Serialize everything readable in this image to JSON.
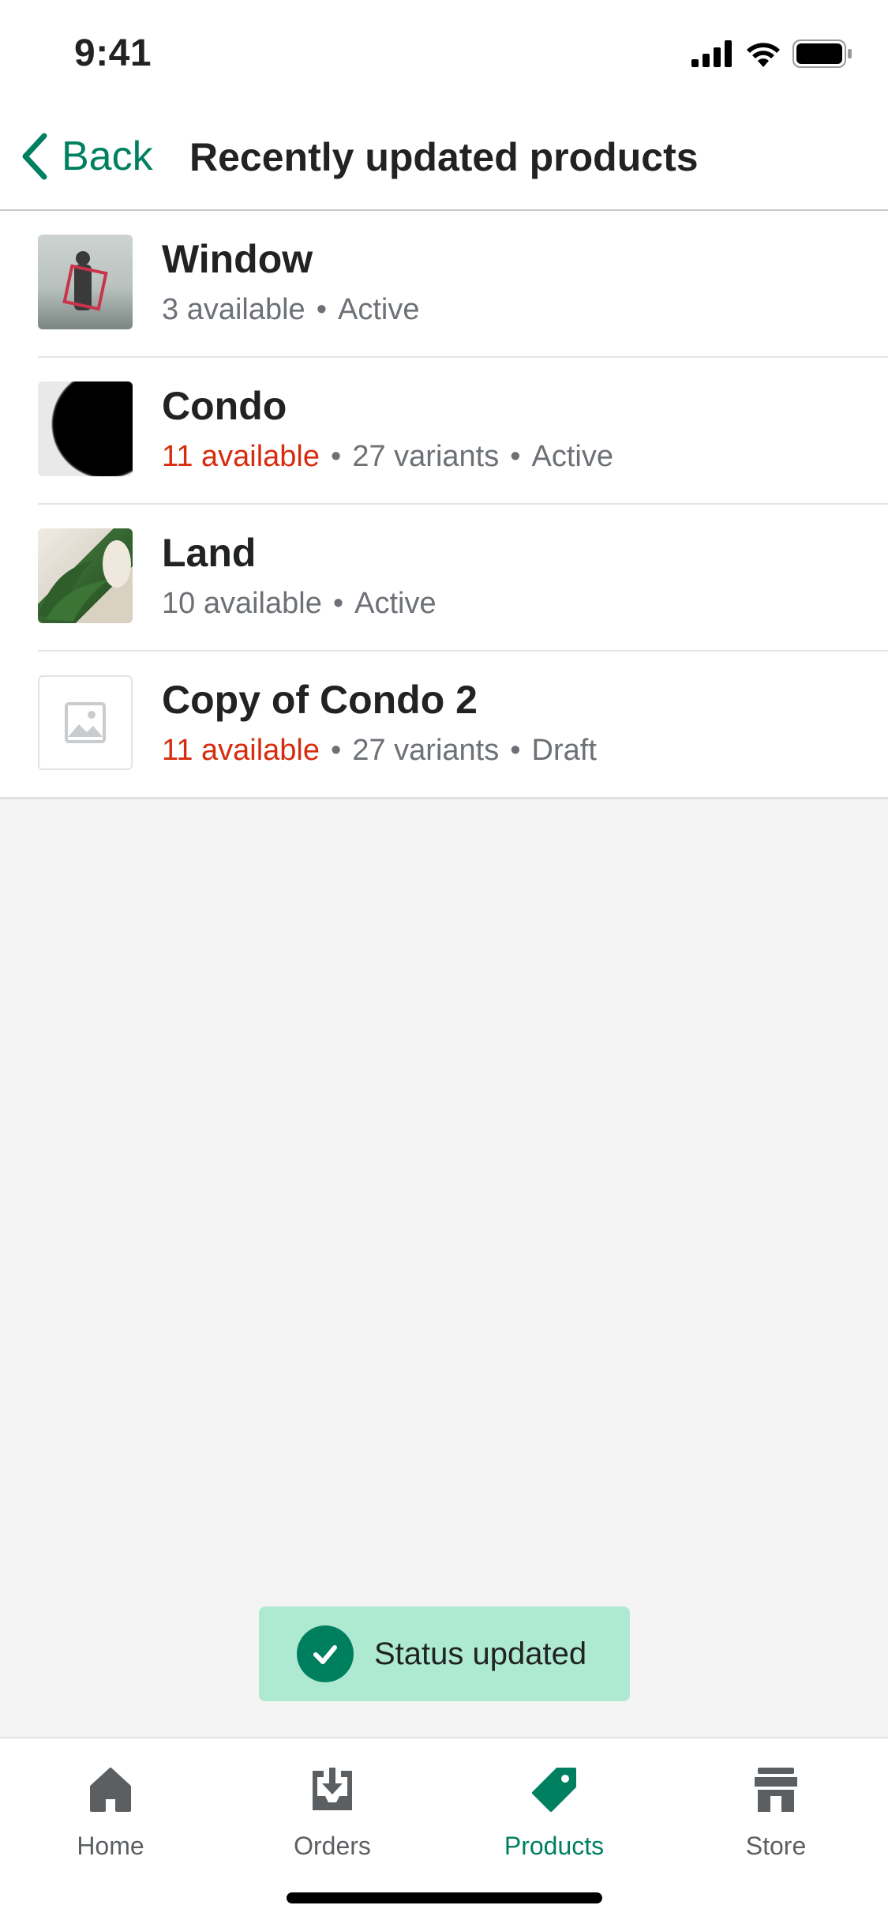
{
  "status_bar": {
    "time": "9:41"
  },
  "nav": {
    "back_label": "Back",
    "title": "Recently updated products"
  },
  "products": [
    {
      "name": "Window",
      "available": "3 available",
      "available_warning": false,
      "variants": "",
      "status": "Active",
      "thumbnail": "photo-person-in-water"
    },
    {
      "name": "Condo",
      "available": "11 available",
      "available_warning": true,
      "variants": "27 variants",
      "status": "Active",
      "thumbnail": "photo-dark-hair"
    },
    {
      "name": "Land",
      "available": "10 available",
      "available_warning": false,
      "variants": "",
      "status": "Active",
      "thumbnail": "photo-plant"
    },
    {
      "name": "Copy of Condo 2",
      "available": "11 available",
      "available_warning": true,
      "variants": "27 variants",
      "status": "Draft",
      "thumbnail": "image-placeholder-icon"
    }
  ],
  "toast": {
    "text": "Status updated",
    "icon": "check-circle-icon"
  },
  "tabbar": {
    "tabs": [
      {
        "label": "Home",
        "icon": "home-icon",
        "active": false
      },
      {
        "label": "Orders",
        "icon": "orders-icon",
        "active": false
      },
      {
        "label": "Products",
        "icon": "tag-icon",
        "active": true
      },
      {
        "label": "Store",
        "icon": "store-icon",
        "active": false
      }
    ]
  },
  "colors": {
    "accent": "#008060",
    "warning": "#d72c0d",
    "toast_bg": "#aee9d1",
    "muted_text": "#6d7175"
  }
}
